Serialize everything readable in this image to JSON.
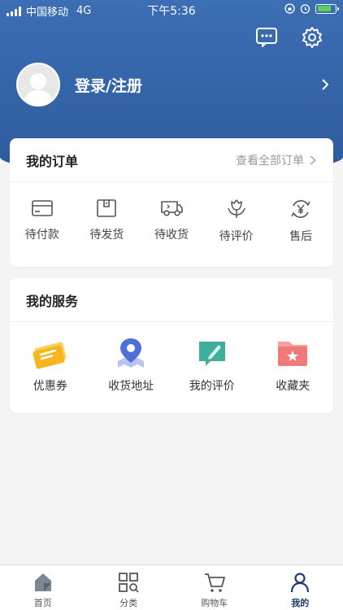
{
  "status_bar": {
    "carrier": "中国移动",
    "network": "4G",
    "time": "下午5:36"
  },
  "header": {
    "login_label": "登录/注册"
  },
  "orders": {
    "title": "我的订单",
    "see_all": "查看全部订单",
    "items": [
      {
        "label": "待付款",
        "icon": "card-icon"
      },
      {
        "label": "待发货",
        "icon": "box-icon"
      },
      {
        "label": "待收货",
        "icon": "truck-icon"
      },
      {
        "label": "待评价",
        "icon": "flower-icon"
      },
      {
        "label": "售后",
        "icon": "yen-refresh-icon"
      }
    ]
  },
  "services": {
    "title": "我的服务",
    "items": [
      {
        "label": "优惠券",
        "icon": "coupon-icon",
        "color": "#f7b520"
      },
      {
        "label": "收货地址",
        "icon": "location-pin-icon",
        "color": "#4f6fd8"
      },
      {
        "label": "我的评价",
        "icon": "comment-edit-icon",
        "color": "#3fae9b"
      },
      {
        "label": "收藏夹",
        "icon": "folder-star-icon",
        "color": "#f07a7a"
      }
    ]
  },
  "tabbar": {
    "items": [
      {
        "label": "首页",
        "icon": "home-icon",
        "active": false
      },
      {
        "label": "分类",
        "icon": "category-grid-icon",
        "active": false
      },
      {
        "label": "购物车",
        "icon": "cart-icon",
        "active": false
      },
      {
        "label": "我的",
        "icon": "user-icon",
        "active": true
      }
    ]
  },
  "colors": {
    "header_blue": "#3c6eb4",
    "active_tab": "#1f3b6b"
  }
}
